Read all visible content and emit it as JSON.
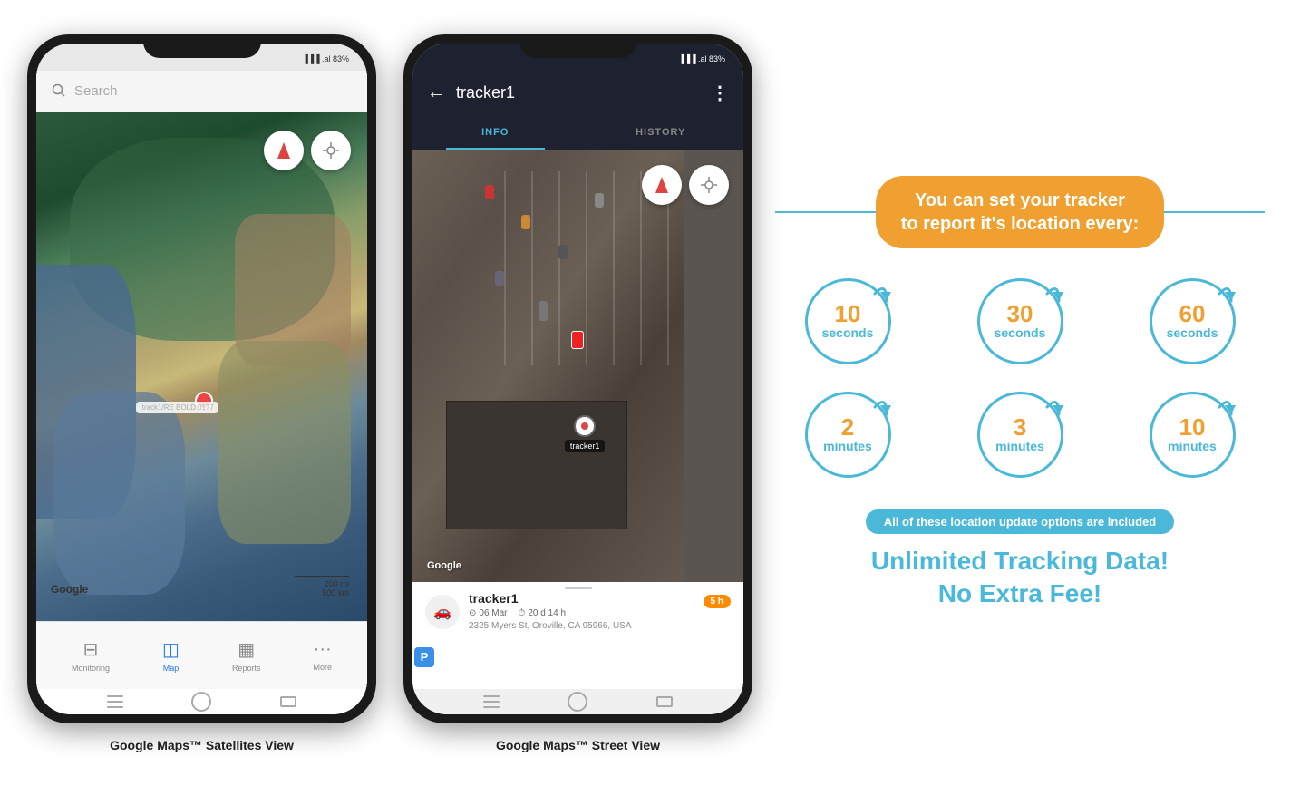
{
  "page": {
    "background": "#ffffff"
  },
  "phone1": {
    "status_time": "",
    "status_right": "▐▐▐ .al 83%",
    "search_placeholder": "Search",
    "map_label": "Google",
    "scale_text1": "200 mi",
    "scale_text2": "500 km",
    "tracker_label": "Itrack1/RE BOLD:0177",
    "nav_items": [
      {
        "icon": "⊟",
        "label": "Monitoring",
        "active": false
      },
      {
        "icon": "◫",
        "label": "Map",
        "active": true
      },
      {
        "icon": "▦",
        "label": "Reports",
        "active": false
      },
      {
        "icon": "···",
        "label": "More",
        "active": false
      }
    ],
    "caption": "Google Maps™ Satellites View"
  },
  "phone2": {
    "status_right": "▐▐▐ .al 83%",
    "back_label": "←",
    "title": "tracker1",
    "more_label": "⋮",
    "tabs": [
      {
        "label": "INFO",
        "active": true
      },
      {
        "label": "HISTORY",
        "active": false
      }
    ],
    "map_label": "Google",
    "compass_label": "↑",
    "card": {
      "tracker_name": "tracker1",
      "date": "06 Mar",
      "duration": "20 d 14 h",
      "address": "2325 Myers St, Oroville, CA 95966, USA",
      "time_badge": "5 h"
    },
    "caption": "Google Maps™ Street View"
  },
  "features": {
    "headline": "You can set your tracker\nto report it's location every:",
    "intervals": [
      {
        "number": "10",
        "unit": "seconds"
      },
      {
        "number": "30",
        "unit": "seconds"
      },
      {
        "number": "60",
        "unit": "seconds"
      },
      {
        "number": "2",
        "unit": "minutes"
      },
      {
        "number": "3",
        "unit": "minutes"
      },
      {
        "number": "10",
        "unit": "minutes"
      }
    ],
    "included_label": "All of these location update options are included",
    "unlimited_line1": "Unlimited Tracking Data!",
    "unlimited_line2": "No Extra Fee!"
  }
}
